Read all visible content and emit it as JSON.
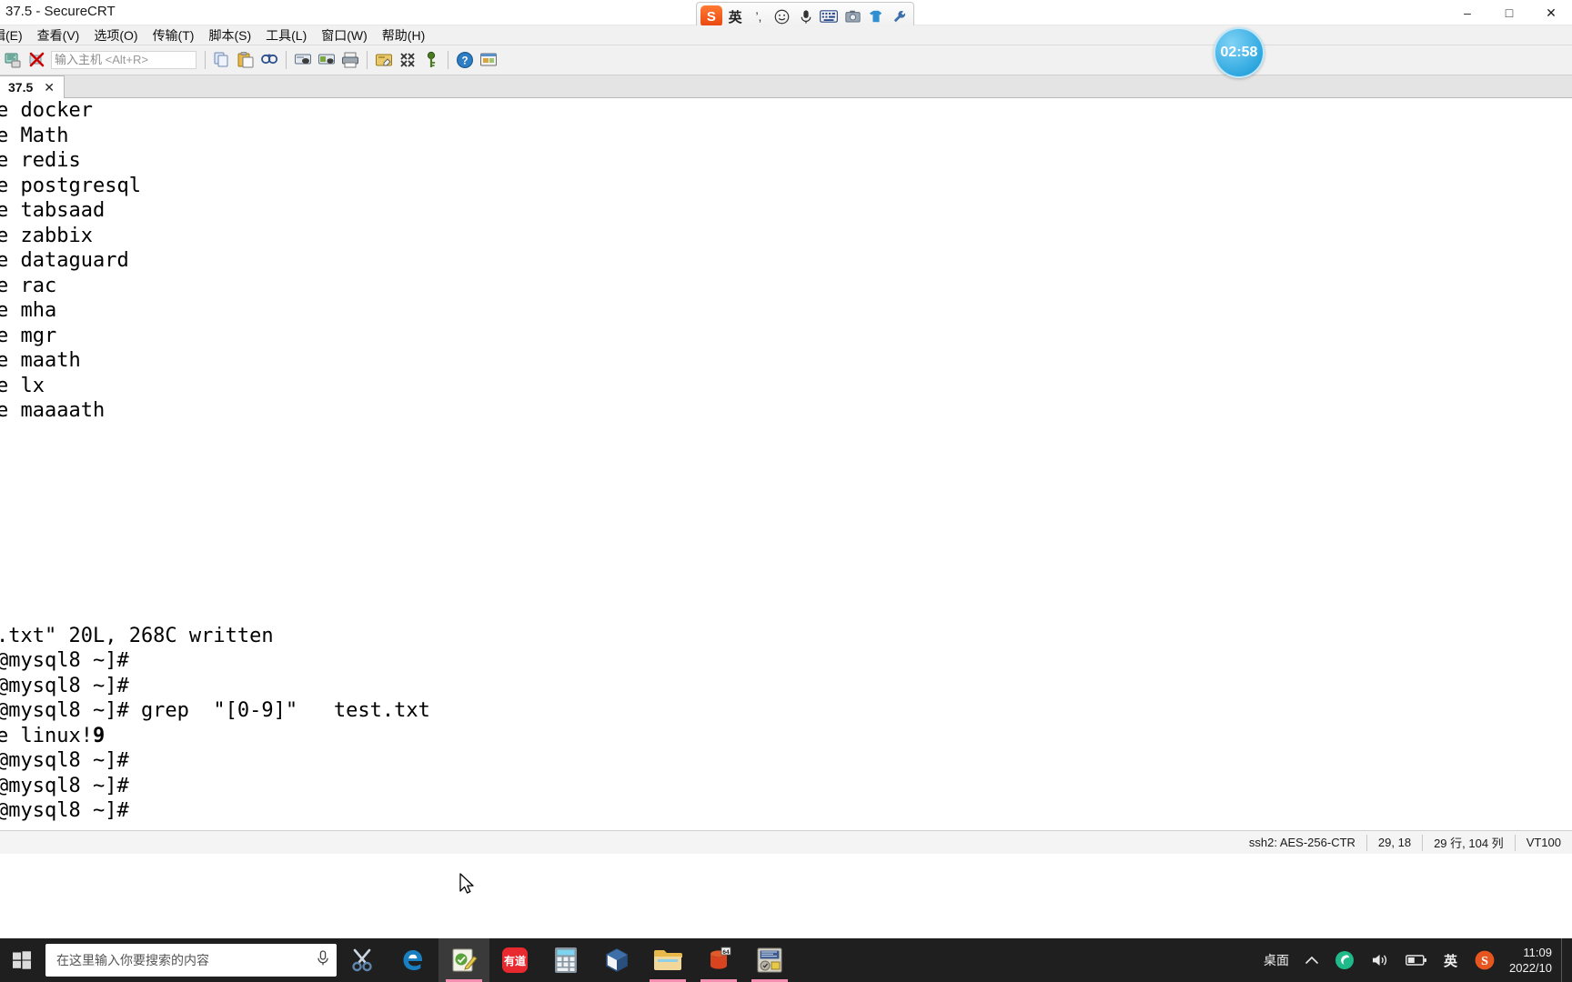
{
  "window": {
    "title": "37.5 - SecureCRT",
    "minimize": "–",
    "maximize": "□",
    "close": "✕"
  },
  "ime_bar": {
    "logo": "S",
    "lang": "英",
    "items": [
      "punctuation-icon",
      "emoji-icon",
      "voice-icon",
      "keyboard-icon",
      "screenshot-icon",
      "skin-icon",
      "toolbox-icon"
    ]
  },
  "menubar": {
    "items": [
      {
        "label": "编辑(E)",
        "name": "menu-edit"
      },
      {
        "label": "查看(V)",
        "name": "menu-view"
      },
      {
        "label": "选项(O)",
        "name": "menu-options"
      },
      {
        "label": "传输(T)",
        "name": "menu-transfer"
      },
      {
        "label": "脚本(S)",
        "name": "menu-script"
      },
      {
        "label": "工具(L)",
        "name": "menu-tools"
      },
      {
        "label": "窗口(W)",
        "name": "menu-window"
      },
      {
        "label": "帮助(H)",
        "name": "menu-help"
      }
    ]
  },
  "toolbar": {
    "host_placeholder": "输入主机",
    "host_hotkey": "<Alt+R>",
    "icons": [
      "new-session-icon",
      "disconnect-icon",
      "copy-icon",
      "paste-icon",
      "find-icon",
      "log-session-icon",
      "print-screen-icon",
      "print-icon",
      "session-options-icon",
      "session-manager-icon",
      "key-icon",
      "help-icon",
      "window-arrange-icon"
    ]
  },
  "tab": {
    "label": "37.5",
    "close": "✕"
  },
  "clock_badge": {
    "time": "02:58"
  },
  "terminal": {
    "lines": [
      {
        "text": "e docker"
      },
      {
        "text": "e Math"
      },
      {
        "text": "e redis"
      },
      {
        "text": "e postgresql"
      },
      {
        "text": "e tabsaad"
      },
      {
        "text": "e zabbix"
      },
      {
        "text": "e dataguard"
      },
      {
        "text": "e rac"
      },
      {
        "text": "e mha"
      },
      {
        "text": "e mgr"
      },
      {
        "text": "e maath"
      },
      {
        "text": "e lx"
      },
      {
        "text": "e maaaath"
      },
      {
        "text": ""
      },
      {
        "text": ""
      },
      {
        "text": ""
      },
      {
        "text": ""
      },
      {
        "text": ""
      },
      {
        "text": ""
      },
      {
        "text": ""
      },
      {
        "text": ""
      },
      {
        "text": ".txt\" 20L, 268C written"
      },
      {
        "text": "@mysql8 ~]#"
      },
      {
        "text": "@mysql8 ~]#"
      },
      {
        "text": "@mysql8 ~]# grep  \"[0-9]\"   test.txt"
      },
      {
        "text": "e linux!",
        "bold_suffix": "9"
      },
      {
        "text": "@mysql8 ~]#"
      },
      {
        "text": "@mysql8 ~]#"
      },
      {
        "text": "@mysql8 ~]#"
      }
    ]
  },
  "statusbar": {
    "protocol": "ssh2: AES-256-CTR",
    "cursor": "29, 18",
    "size": "29 行, 104 列",
    "emulation": "VT100"
  },
  "taskbar": {
    "search_placeholder": "在这里输入你要搜索的内容",
    "start_icon": "windows-start-icon",
    "mic_icon": "microphone-icon",
    "apps": [
      {
        "name": "snipping-tool-icon",
        "active": false,
        "running": false
      },
      {
        "name": "microsoft-edge-icon",
        "active": false,
        "running": false
      },
      {
        "name": "editplus-icon",
        "active": true,
        "running": true
      },
      {
        "name": "youdao-dictionary-icon",
        "active": false,
        "running": false
      },
      {
        "name": "calculator-icon",
        "active": false,
        "running": false
      },
      {
        "name": "virtualbox-icon",
        "active": false,
        "running": false
      },
      {
        "name": "file-explorer-icon",
        "active": false,
        "running": true
      },
      {
        "name": "navicat-icon",
        "active": false,
        "running": true
      },
      {
        "name": "securecrt-icon",
        "active": false,
        "running": true
      }
    ],
    "tray": {
      "desktop_label": "桌面",
      "expand": "chevron-up-icon",
      "items": [
        "netease-music-icon",
        "volume-icon",
        "battery-icon"
      ],
      "ime_label": "英",
      "sogou_logo": "S",
      "time": "11:09",
      "date": "2022/10"
    }
  }
}
